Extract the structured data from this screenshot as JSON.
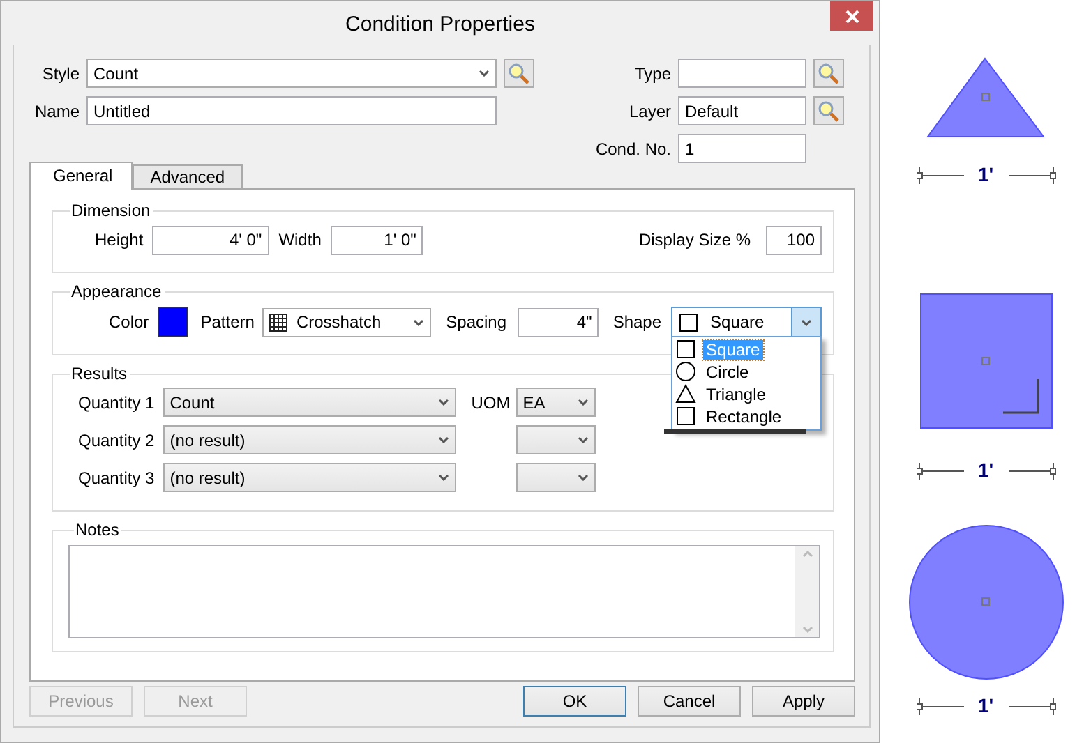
{
  "window": {
    "title": "Condition Properties"
  },
  "header_left": [
    {
      "label": "Style",
      "value": "Count",
      "kind": "select",
      "lookup": true
    },
    {
      "label": "Name",
      "value": "Untitled",
      "kind": "text",
      "lookup": false
    }
  ],
  "header_right": [
    {
      "label": "Type",
      "lookup": true
    },
    {
      "label": "Layer",
      "value": "Default",
      "lookup": true
    },
    {
      "label": "Cond. No.",
      "value": "1",
      "lookup": false
    }
  ],
  "tabs": [
    {
      "label": "General",
      "selected": true
    },
    {
      "label": "Advanced",
      "selected": false
    }
  ],
  "dimension": {
    "title": "Dimension",
    "height": {
      "label": "Height",
      "value": "4' 0\""
    },
    "width": {
      "label": "Width",
      "value": "1' 0\""
    },
    "display_size": {
      "label": "Display Size %",
      "value": "100"
    }
  },
  "appearance": {
    "title": "Appearance",
    "color": {
      "label": "Color",
      "color": "#0000ff"
    },
    "pattern": {
      "label": "Pattern",
      "value": "Crosshatch"
    },
    "spacing": {
      "label": "Spacing",
      "value": "4\""
    },
    "shape": {
      "label": "Shape",
      "value": "Square",
      "kind": "square",
      "expanded": true,
      "options": [
        {
          "label": "Square",
          "kind": "square",
          "selected": true
        },
        {
          "label": "Circle",
          "kind": "circle",
          "selected": false
        },
        {
          "label": "Triangle",
          "kind": "triangle",
          "selected": false
        },
        {
          "label": "Rectangle",
          "kind": "square",
          "selected": false
        }
      ]
    }
  },
  "results": {
    "title": "Results",
    "uom_label": "UOM",
    "rows": [
      {
        "label": "Quantity 1",
        "value": "Count",
        "uom": "EA"
      },
      {
        "label": "Quantity 2",
        "value": "(no result)"
      },
      {
        "label": "Quantity 3",
        "value": "(no result)"
      }
    ]
  },
  "notes": {
    "title": "Notes"
  },
  "nav_buttons": [
    {
      "label": "Previous",
      "disabled": true
    },
    {
      "label": "Next",
      "disabled": true
    }
  ],
  "buttons": [
    {
      "label": "OK",
      "default": true
    },
    {
      "label": "Cancel",
      "default": false
    },
    {
      "label": "Apply",
      "default": false
    }
  ],
  "previews": [
    {
      "kind": "triangle",
      "dimension": "1'"
    },
    {
      "kind": "square",
      "dimension": "1'"
    },
    {
      "kind": "circle",
      "dimension": "1'"
    }
  ]
}
